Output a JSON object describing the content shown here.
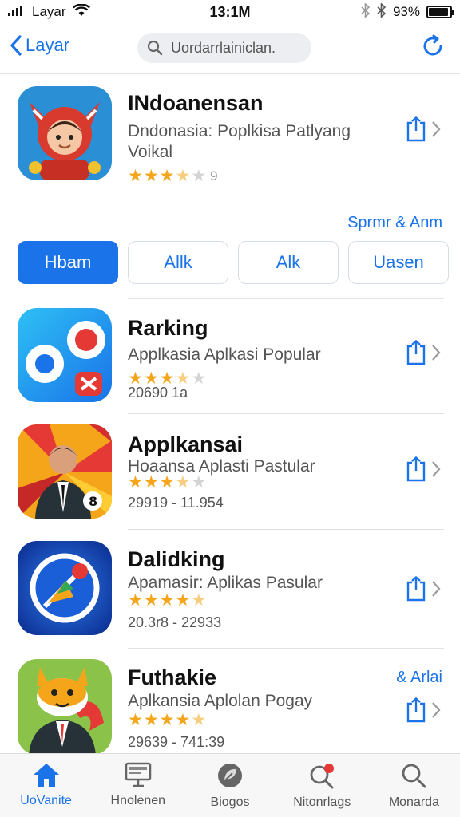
{
  "status_bar": {
    "carrier": "Layar",
    "time": "13:1M",
    "battery_text": "93%",
    "battery_level": 0.93
  },
  "nav": {
    "back_label": "Layar",
    "search_placeholder": "Uordarrlainiclan."
  },
  "featured": {
    "title": "INdoanensan",
    "subtitle_line1": "Dndonasia: Poplkisa Patlyang",
    "subtitle_line2": "Voikal",
    "rating": 3.5,
    "rating_extra": "9"
  },
  "section_link": "Sprmr & Anm",
  "tabs": [
    {
      "label": "Hbam",
      "active": true
    },
    {
      "label": "Allk",
      "active": false
    },
    {
      "label": "Alk",
      "active": false
    },
    {
      "label": "Uasen",
      "active": false
    }
  ],
  "apps": [
    {
      "title": "Rarking",
      "subtitle": "Applkasia Aplkasi Popular",
      "rating": 3.5,
      "meta": "20690      1a",
      "tag": ""
    },
    {
      "title": "Applkansai",
      "subtitle": "Hoaansa  Aplasti Pastular",
      "rating": 3.5,
      "meta": "29919 - 11.954",
      "tag": ""
    },
    {
      "title": "Dalidking",
      "subtitle": "Apamasir: Aplikas Pasular",
      "rating": 4.5,
      "meta": "20.3r8 - 22933",
      "tag": ""
    },
    {
      "title": "Futhakie",
      "subtitle": "Aplkansia Aplolan Pogay",
      "rating": 4.5,
      "meta": "29639 - 741:39",
      "tag": "& Arlai"
    }
  ],
  "tabbar": [
    {
      "label": "UoVanite",
      "icon": "home-icon",
      "active": true
    },
    {
      "label": "Hnolenen",
      "icon": "monitor-icon",
      "active": false
    },
    {
      "label": "Biogos",
      "icon": "leaf-icon",
      "active": false
    },
    {
      "label": "Nitonrlags",
      "icon": "search-badge-icon",
      "active": false
    },
    {
      "label": "Monarda",
      "icon": "search-icon",
      "active": false
    }
  ],
  "colors": {
    "accent": "#1a73e8",
    "star": "#f4a51a"
  }
}
